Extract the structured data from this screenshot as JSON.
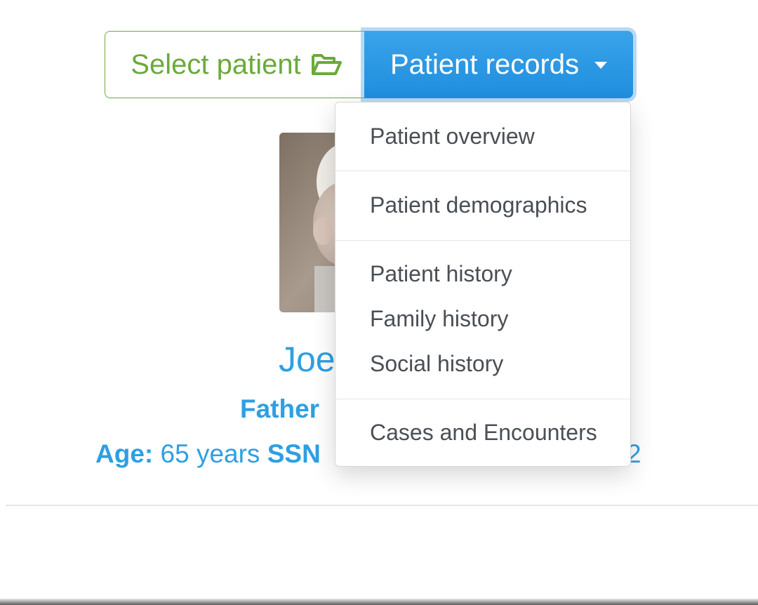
{
  "toolbar": {
    "select_patient_label": "Select patient",
    "select_patient_icon": "folder-open-icon",
    "patient_records_label": "Patient records",
    "patient_records_icon": "caret-down-icon",
    "colors": {
      "select_accent": "#6aaa3a",
      "records_bg": "#2a98e6",
      "records_text": "#ffffff"
    }
  },
  "dropdown": {
    "items": [
      {
        "label": "Patient overview"
      },
      {
        "label": "Patient demographics"
      },
      {
        "label": "Patient history"
      },
      {
        "label": "Family history"
      },
      {
        "label": "Social history"
      },
      {
        "label": "Cases and Encounters"
      }
    ]
  },
  "patient": {
    "name_visible": "Joe",
    "role_visible": "Father",
    "age_label": "Age:",
    "age_value": "65 years",
    "ssn_label": "SSN",
    "ssn_visible_tail": "2",
    "accent_color": "#2e9fe3"
  }
}
